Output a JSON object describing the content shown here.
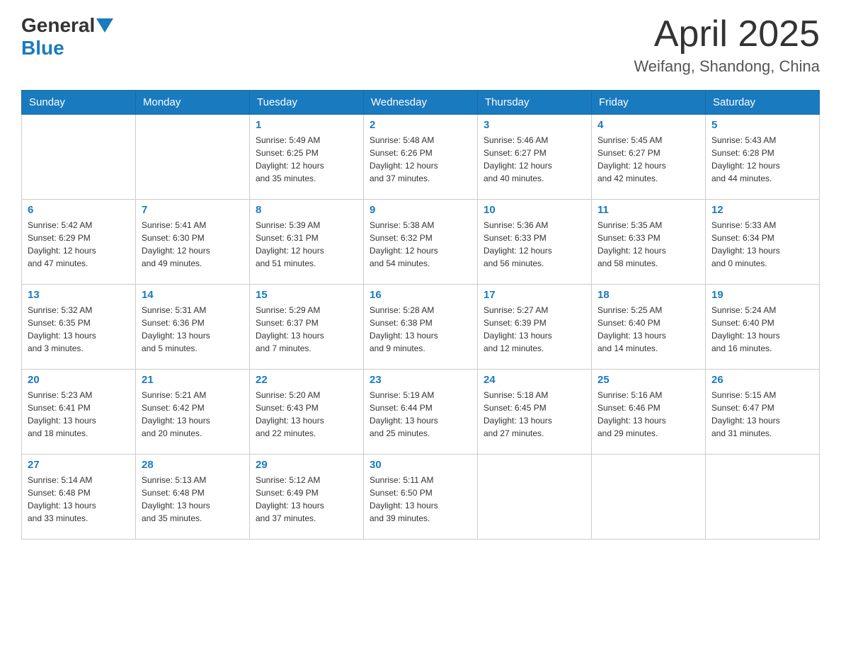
{
  "header": {
    "logo_general": "General",
    "logo_blue": "Blue",
    "month_title": "April 2025",
    "location": "Weifang, Shandong, China"
  },
  "days_of_week": [
    "Sunday",
    "Monday",
    "Tuesday",
    "Wednesday",
    "Thursday",
    "Friday",
    "Saturday"
  ],
  "weeks": [
    [
      {
        "day": "",
        "info": ""
      },
      {
        "day": "",
        "info": ""
      },
      {
        "day": "1",
        "info": "Sunrise: 5:49 AM\nSunset: 6:25 PM\nDaylight: 12 hours\nand 35 minutes."
      },
      {
        "day": "2",
        "info": "Sunrise: 5:48 AM\nSunset: 6:26 PM\nDaylight: 12 hours\nand 37 minutes."
      },
      {
        "day": "3",
        "info": "Sunrise: 5:46 AM\nSunset: 6:27 PM\nDaylight: 12 hours\nand 40 minutes."
      },
      {
        "day": "4",
        "info": "Sunrise: 5:45 AM\nSunset: 6:27 PM\nDaylight: 12 hours\nand 42 minutes."
      },
      {
        "day": "5",
        "info": "Sunrise: 5:43 AM\nSunset: 6:28 PM\nDaylight: 12 hours\nand 44 minutes."
      }
    ],
    [
      {
        "day": "6",
        "info": "Sunrise: 5:42 AM\nSunset: 6:29 PM\nDaylight: 12 hours\nand 47 minutes."
      },
      {
        "day": "7",
        "info": "Sunrise: 5:41 AM\nSunset: 6:30 PM\nDaylight: 12 hours\nand 49 minutes."
      },
      {
        "day": "8",
        "info": "Sunrise: 5:39 AM\nSunset: 6:31 PM\nDaylight: 12 hours\nand 51 minutes."
      },
      {
        "day": "9",
        "info": "Sunrise: 5:38 AM\nSunset: 6:32 PM\nDaylight: 12 hours\nand 54 minutes."
      },
      {
        "day": "10",
        "info": "Sunrise: 5:36 AM\nSunset: 6:33 PM\nDaylight: 12 hours\nand 56 minutes."
      },
      {
        "day": "11",
        "info": "Sunrise: 5:35 AM\nSunset: 6:33 PM\nDaylight: 12 hours\nand 58 minutes."
      },
      {
        "day": "12",
        "info": "Sunrise: 5:33 AM\nSunset: 6:34 PM\nDaylight: 13 hours\nand 0 minutes."
      }
    ],
    [
      {
        "day": "13",
        "info": "Sunrise: 5:32 AM\nSunset: 6:35 PM\nDaylight: 13 hours\nand 3 minutes."
      },
      {
        "day": "14",
        "info": "Sunrise: 5:31 AM\nSunset: 6:36 PM\nDaylight: 13 hours\nand 5 minutes."
      },
      {
        "day": "15",
        "info": "Sunrise: 5:29 AM\nSunset: 6:37 PM\nDaylight: 13 hours\nand 7 minutes."
      },
      {
        "day": "16",
        "info": "Sunrise: 5:28 AM\nSunset: 6:38 PM\nDaylight: 13 hours\nand 9 minutes."
      },
      {
        "day": "17",
        "info": "Sunrise: 5:27 AM\nSunset: 6:39 PM\nDaylight: 13 hours\nand 12 minutes."
      },
      {
        "day": "18",
        "info": "Sunrise: 5:25 AM\nSunset: 6:40 PM\nDaylight: 13 hours\nand 14 minutes."
      },
      {
        "day": "19",
        "info": "Sunrise: 5:24 AM\nSunset: 6:40 PM\nDaylight: 13 hours\nand 16 minutes."
      }
    ],
    [
      {
        "day": "20",
        "info": "Sunrise: 5:23 AM\nSunset: 6:41 PM\nDaylight: 13 hours\nand 18 minutes."
      },
      {
        "day": "21",
        "info": "Sunrise: 5:21 AM\nSunset: 6:42 PM\nDaylight: 13 hours\nand 20 minutes."
      },
      {
        "day": "22",
        "info": "Sunrise: 5:20 AM\nSunset: 6:43 PM\nDaylight: 13 hours\nand 22 minutes."
      },
      {
        "day": "23",
        "info": "Sunrise: 5:19 AM\nSunset: 6:44 PM\nDaylight: 13 hours\nand 25 minutes."
      },
      {
        "day": "24",
        "info": "Sunrise: 5:18 AM\nSunset: 6:45 PM\nDaylight: 13 hours\nand 27 minutes."
      },
      {
        "day": "25",
        "info": "Sunrise: 5:16 AM\nSunset: 6:46 PM\nDaylight: 13 hours\nand 29 minutes."
      },
      {
        "day": "26",
        "info": "Sunrise: 5:15 AM\nSunset: 6:47 PM\nDaylight: 13 hours\nand 31 minutes."
      }
    ],
    [
      {
        "day": "27",
        "info": "Sunrise: 5:14 AM\nSunset: 6:48 PM\nDaylight: 13 hours\nand 33 minutes."
      },
      {
        "day": "28",
        "info": "Sunrise: 5:13 AM\nSunset: 6:48 PM\nDaylight: 13 hours\nand 35 minutes."
      },
      {
        "day": "29",
        "info": "Sunrise: 5:12 AM\nSunset: 6:49 PM\nDaylight: 13 hours\nand 37 minutes."
      },
      {
        "day": "30",
        "info": "Sunrise: 5:11 AM\nSunset: 6:50 PM\nDaylight: 13 hours\nand 39 minutes."
      },
      {
        "day": "",
        "info": ""
      },
      {
        "day": "",
        "info": ""
      },
      {
        "day": "",
        "info": ""
      }
    ]
  ]
}
